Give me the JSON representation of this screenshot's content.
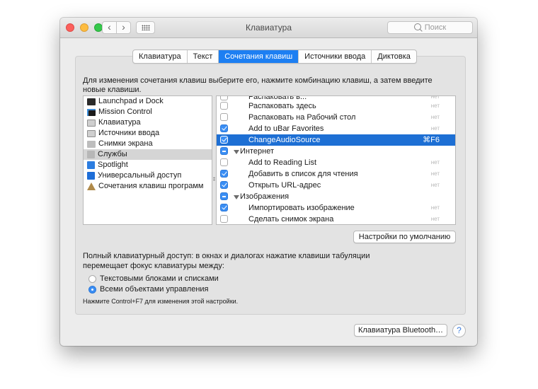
{
  "window": {
    "title": "Клавиатура"
  },
  "search": {
    "placeholder": "Поиск"
  },
  "icons": {
    "back": "chevron-left-icon",
    "forward": "chevron-right-icon",
    "grid": "grid-icon",
    "search": "search-icon"
  },
  "tabs": [
    {
      "label": "Клавиатура",
      "selected": false
    },
    {
      "label": "Текст",
      "selected": false
    },
    {
      "label": "Сочетания клавиш",
      "selected": true
    },
    {
      "label": "Источники ввода",
      "selected": false
    },
    {
      "label": "Диктовка",
      "selected": false
    }
  ],
  "hint": "Для изменения сочетания клавиш выберите его, нажмите комбинацию клавиш, а затем введите новые клавиши.",
  "categories": [
    {
      "label": "Launchpad и Dock",
      "icon": "launchpad-icon",
      "selected": false
    },
    {
      "label": "Mission Control",
      "icon": "mission-control-icon",
      "selected": false
    },
    {
      "label": "Клавиатура",
      "icon": "keyboard-icon",
      "selected": false
    },
    {
      "label": "Источники ввода",
      "icon": "input-sources-icon",
      "selected": false
    },
    {
      "label": "Снимки экрана",
      "icon": "screenshot-icon",
      "selected": false
    },
    {
      "label": "Службы",
      "icon": "services-gear-icon",
      "selected": true
    },
    {
      "label": "Spotlight",
      "icon": "spotlight-icon",
      "selected": false
    },
    {
      "label": "Универсальный доступ",
      "icon": "accessibility-icon",
      "selected": false
    },
    {
      "label": "Сочетания клавиш программ",
      "icon": "app-shortcuts-icon",
      "selected": false
    }
  ],
  "shortcuts": [
    {
      "type": "item",
      "label": "Распаковать в...",
      "key": "нет",
      "checked": false,
      "cut": true
    },
    {
      "type": "item",
      "label": "Распаковать здесь",
      "key": "нет",
      "checked": false
    },
    {
      "type": "item",
      "label": "Распаковать на Рабочий стол",
      "key": "нет",
      "checked": false
    },
    {
      "type": "item",
      "label": "Add to uBar Favorites",
      "key": "нет",
      "checked": true
    },
    {
      "type": "item",
      "label": "ChangeAudioSource",
      "key": "⌘F6",
      "checked": true,
      "selected": true
    },
    {
      "type": "group",
      "label": "Интернет",
      "state": "mixed"
    },
    {
      "type": "item",
      "label": "Add to Reading List",
      "key": "нет",
      "checked": false
    },
    {
      "type": "item",
      "label": "Добавить в список для чтения",
      "key": "нет",
      "checked": true
    },
    {
      "type": "item",
      "label": "Открыть URL-адрес",
      "key": "нет",
      "checked": true
    },
    {
      "type": "group",
      "label": "Изображения",
      "state": "mixed"
    },
    {
      "type": "item",
      "label": "Импортировать изображение",
      "key": "нет",
      "checked": true
    },
    {
      "type": "item",
      "label": "Сделать снимок экрана",
      "key": "нет",
      "checked": false
    }
  ],
  "buttons": {
    "defaults": "Настройки по умолчанию",
    "bluetooth": "Клавиатура Bluetooth…",
    "help": "?"
  },
  "full_keyboard_access": {
    "text": "Полный клавиатурный доступ: в окнах и диалогах нажатие клавиши табуляции перемещает фокус клавиатуры между:",
    "options": [
      {
        "label": "Текстовыми блоками и списками",
        "selected": false
      },
      {
        "label": "Всеми объектами управления",
        "selected": true
      }
    ],
    "note": "Нажмите Control+F7 для изменения этой настройки."
  },
  "colors": {
    "accent": "#1d7ff2",
    "selection": "#1d6fd4"
  }
}
